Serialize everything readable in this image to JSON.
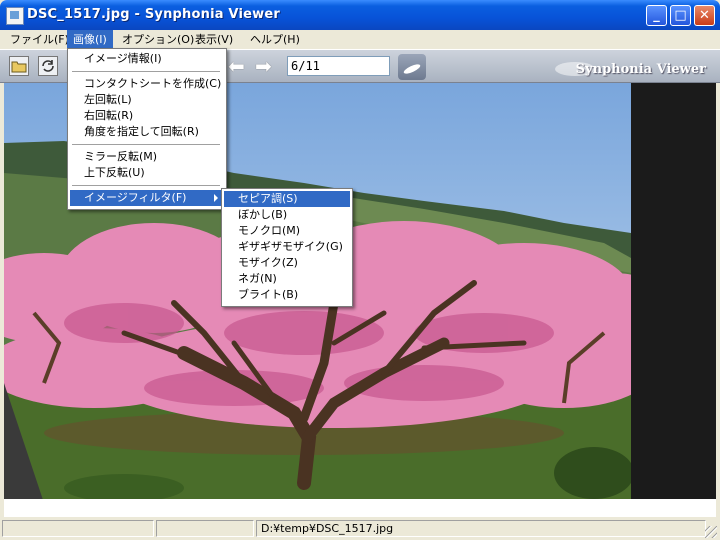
{
  "window": {
    "title": "DSC_1517.jpg - Synphonia Viewer",
    "controls": {
      "minimize": "_",
      "maximize": "□",
      "close": "✕"
    }
  },
  "menubar": [
    {
      "label": "ファイル(F)"
    },
    {
      "label": "画像(I)"
    },
    {
      "label": "オプション(O)"
    },
    {
      "label": "表示(V)"
    },
    {
      "label": "ヘルプ(H)"
    }
  ],
  "toolbar": {
    "open_icon": "folder-open-icon",
    "refresh_icon": "refresh-icon",
    "prev_icon": "left-arrow-icon",
    "next_icon": "right-arrow-icon",
    "page_value": "6/11",
    "brand": "Synphonia Viewer"
  },
  "image_menu": {
    "items": [
      "イメージ情報(I)",
      "コンタクトシートを作成(C)",
      "左回転(L)",
      "右回転(R)",
      "角度を指定して回転(R)",
      "ミラー反転(M)",
      "上下反転(U)",
      "イメージフィルタ(F)"
    ]
  },
  "filter_menu": {
    "items": [
      "セピア調(S)",
      "ぼかし(B)",
      "モノクロ(M)",
      "ギザギザモザイク(G)",
      "モザイク(Z)",
      "ネガ(N)",
      "ブライト(B)"
    ]
  },
  "status": {
    "pane1": "",
    "pane2": "",
    "path": "D:¥temp¥DSC_1517.jpg"
  },
  "colors": {
    "titlebar": "#0853d8",
    "highlight": "#316ac5",
    "viewer_bg": "#1b1b1b"
  }
}
